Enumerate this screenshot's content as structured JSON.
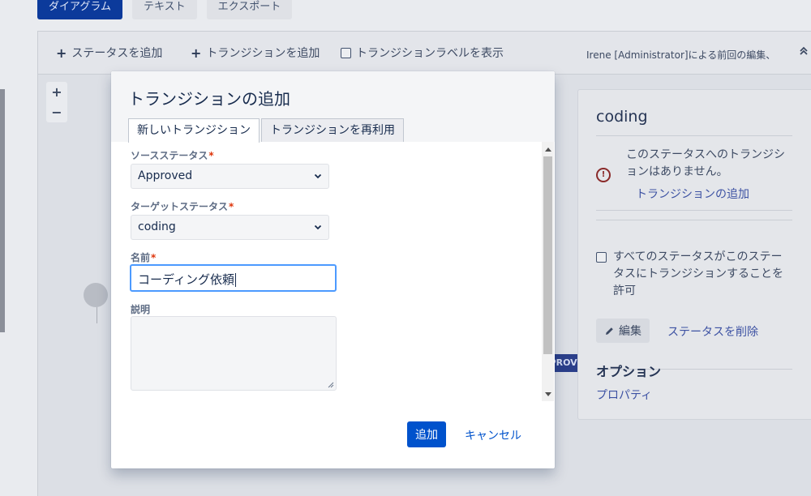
{
  "background": {
    "top_tabs": [
      {
        "label": "ダイアグラム",
        "active": true
      },
      {
        "label": "テキスト",
        "active": false
      },
      {
        "label": "エクスポート",
        "active": false
      }
    ],
    "toolbar": {
      "add_status": "ステータスを追加",
      "add_transition": "トランジションを追加",
      "show_transition_labels": "トランジションラベルを表示",
      "last_edited": "Irene [Administrator]による前回の編集、",
      "collapse_icon": "double-chevron-up-icon"
    },
    "zoom": {
      "in": "+",
      "out": "−"
    },
    "approved_chip": "APPROVED",
    "right_panel": {
      "title": "coding",
      "warning_text": "このステータスへのトランジションはありません。",
      "add_transition_link": "トランジションの追加",
      "allow_all_text": "すべてのステータスがこのステータスにトランジションすることを許可",
      "edit_button": "編集",
      "delete_status_link": "ステータスを削除",
      "options_heading": "オプション",
      "properties_link": "プロパティ"
    }
  },
  "dialog": {
    "title": "トランジションの追加",
    "tabs": [
      {
        "label": "新しいトランジション",
        "active": true
      },
      {
        "label": "トランジションを再利用",
        "active": false
      }
    ],
    "fields": {
      "source_status": {
        "label": "ソースステータス",
        "required": "*",
        "value": "Approved"
      },
      "target_status": {
        "label": "ターゲットステータス",
        "required": "*",
        "value": "coding"
      },
      "name": {
        "label": "名前",
        "required": "*",
        "value": "コーディング依頼"
      },
      "description": {
        "label": "説明",
        "value": ""
      }
    },
    "buttons": {
      "submit": "追加",
      "cancel": "キャンセル"
    }
  },
  "colors": {
    "primary": "#0052cc",
    "focus_ring": "#4c9aff",
    "required": "#de350b",
    "selected_tab": "#0c3a9b"
  }
}
